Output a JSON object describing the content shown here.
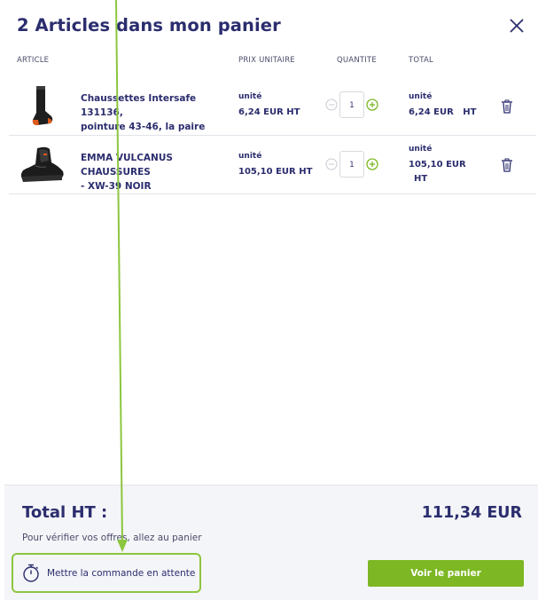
{
  "header": {
    "title": "2 Articles dans mon panier",
    "close_icon": "close-icon"
  },
  "columns": {
    "article": "ARTICLE",
    "unit_price": "PRIX UNITAIRE",
    "quantity": "QUANTITE",
    "total": "TOTAL"
  },
  "items": [
    {
      "name_line1": "Chaussettes Intersafe 131136,",
      "name_line2": "pointure 43-46, la paire",
      "unit_label": "unité",
      "unit_price": "6,24 EUR HT",
      "quantity": "1",
      "total_unit_label": "unité",
      "total_line1": "6,24 EUR   HT",
      "total_line2": ""
    },
    {
      "name_line1": "EMMA VULCANUS CHAUSSURES",
      "name_line2": "- XW-39 NOIR",
      "unit_label": "unité",
      "unit_price": "105,10 EUR HT",
      "quantity": "1",
      "total_unit_label": "unité",
      "total_line1": "105,10 EUR",
      "total_line2": "HT"
    }
  ],
  "footer": {
    "total_label": "Total HT :",
    "total_value": "111,34 EUR",
    "hint": "Pour vérifier vos offres, allez au panier",
    "hold_label": "Mettre la commande en attente",
    "cart_button": "Voir le panier"
  },
  "colors": {
    "navy": "#2b2d6e",
    "green": "#7db724",
    "highlight": "#8cc63f"
  }
}
